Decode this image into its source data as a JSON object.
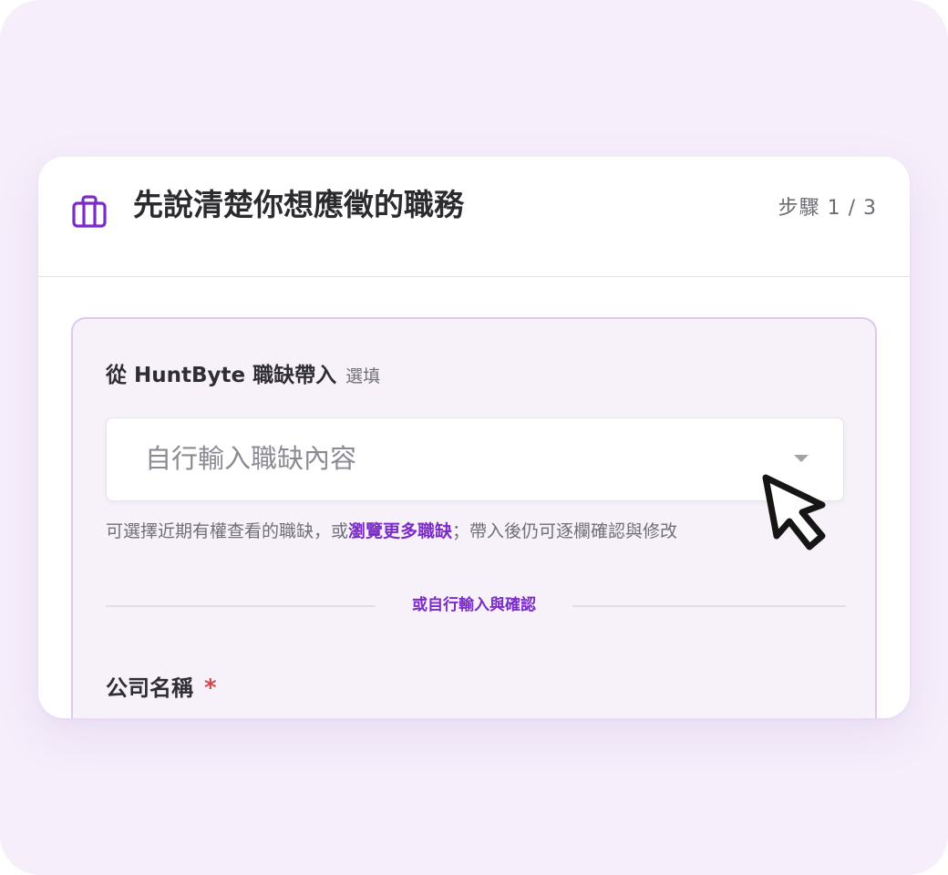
{
  "header": {
    "icon": "briefcase-icon",
    "title": "先說清楚你想應徵的職務",
    "step": "步驟 1 / 3"
  },
  "import_section": {
    "label": "從 HuntByte 職缺帶入",
    "optional": "選填",
    "select_value": "自行輸入職缺內容",
    "helper_before": "可選擇近期有權查看的職缺，或",
    "helper_link": "瀏覽更多職缺",
    "helper_after": "；帶入後仍可逐欄確認與修改"
  },
  "divider": {
    "text": "或自行輸入與確認"
  },
  "company": {
    "label": "公司名稱",
    "required_mark": "*"
  },
  "colors": {
    "accent": "#7b2bc8",
    "required": "#d24848",
    "background": "#f6eefb"
  }
}
